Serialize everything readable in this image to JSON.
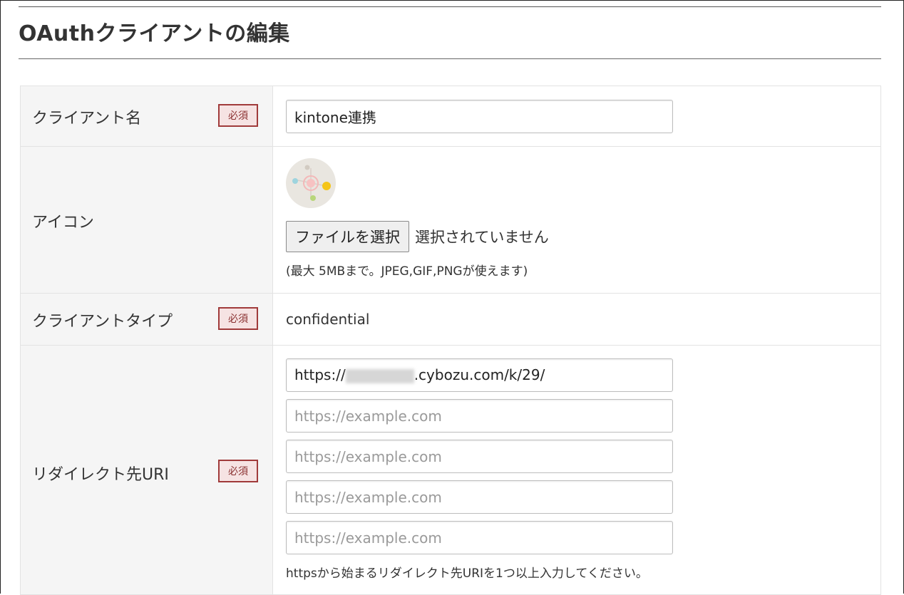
{
  "page": {
    "title": "OAuthクライアントの編集"
  },
  "required_label": "必須",
  "fields": {
    "client_name": {
      "label": "クライアント名",
      "value": "kintone連携"
    },
    "icon": {
      "label": "アイコン",
      "file_button": "ファイルを選択",
      "file_status": "選択されていません",
      "hint": "(最大 5MBまで。JPEG,GIF,PNGが使えます)"
    },
    "client_type": {
      "label": "クライアントタイプ",
      "value": "confidential"
    },
    "redirect_uri": {
      "label": "リダイレクト先URI",
      "first_prefix": "https://",
      "first_suffix": ".cybozu.com/k/29/",
      "placeholder": "https://example.com",
      "hint": "httpsから始まるリダイレクト先URIを1つ以上入力してください。"
    }
  },
  "colors": {
    "required_border": "#a03a3a",
    "required_bg": "#f6e3e3",
    "label_bg": "#f5f5f5"
  }
}
